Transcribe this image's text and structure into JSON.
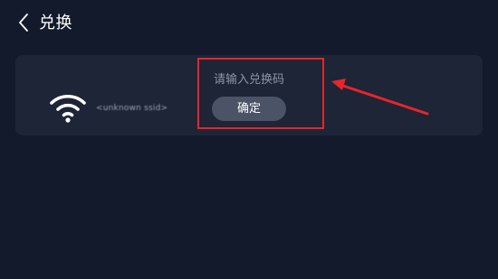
{
  "header": {
    "title": "兑换",
    "back_icon": "chevron-left-icon"
  },
  "network": {
    "icon": "wifi-icon",
    "ssid": "<unknown ssid>"
  },
  "redeem": {
    "placeholder": "请输入兑换码",
    "value": "",
    "confirm_label": "确定"
  },
  "annotation": {
    "highlight_color": "#e8242d"
  },
  "colors": {
    "background": "#131a2b",
    "card": "#1d2537",
    "button": "#4b5366"
  }
}
